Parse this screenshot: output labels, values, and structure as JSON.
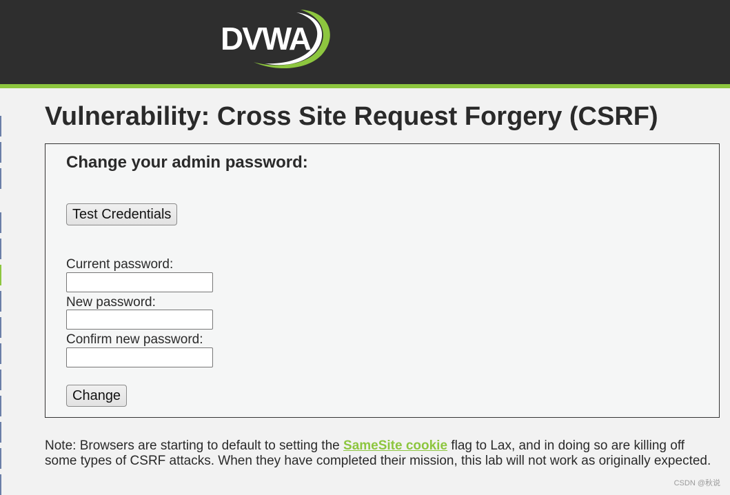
{
  "header": {
    "logo_text": "DVWA",
    "accent_color": "#8dc63f",
    "background_color": "#2e2e2e"
  },
  "main": {
    "title": "Vulnerability: Cross Site Request Forgery (CSRF)",
    "form": {
      "heading": "Change your admin password:",
      "test_credentials_label": "Test Credentials",
      "current_password_label": "Current password:",
      "current_password_value": "",
      "new_password_label": "New password:",
      "new_password_value": "",
      "confirm_password_label": "Confirm new password:",
      "confirm_password_value": "",
      "change_label": "Change"
    },
    "note": {
      "before": "Note: Browsers are starting to default to setting the ",
      "link_text": "SameSite cookie",
      "after": " flag to Lax, and in doing so are killing off some types of CSRF attacks. When they have completed their mission, this lab will not work as originally expected."
    }
  },
  "watermark": "CSDN @秋说"
}
